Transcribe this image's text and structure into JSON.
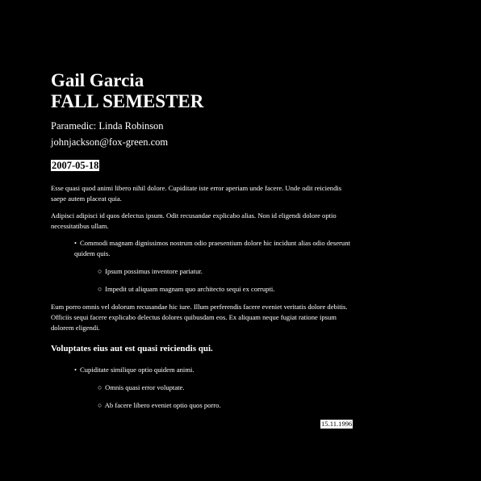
{
  "header": {
    "name": "Gail Garcia",
    "semester": "FALL SEMESTER",
    "role_line": "Paramedic: Linda Robinson",
    "email": "johnjackson@fox-green.com",
    "date": "2007-05-18"
  },
  "body": {
    "paragraph_1": "Esse quasi quod animi libero nihil dolore. Cupiditate iste error aperiam unde facere. Unde odit reiciendis saepe autem placeat quia.",
    "paragraph_2": "Adipisci adipisci id quos delectus ipsum. Odit recusandae explicabo alias. Non id eligendi dolore optio necessitatibus ullam.",
    "list_1": {
      "item_1": "Commodi magnam dignissimos nostrum odio praesentium dolore hic incidunt alias odio deserunt quidem quis.",
      "subitems": [
        "Ipsum possimus inventore pariatur.",
        "Impedit ut aliquam magnam quo architecto sequi ex corrupti."
      ]
    },
    "paragraph_3": "Eum porro omnis vel dolorum recusandae hic iure. Illum perferendis facere eveniet veritatis dolore debitis. Officiis sequi facere explicabo delectus dolores quibusdam eos. Ex aliquam neque fugiat ratione ipsum dolorem eligendi.",
    "heading": "Voluptates eius aut est quasi reiciendis qui.",
    "list_2": {
      "item_1": "Cupiditate similique optio quidem animi.",
      "subitems": [
        "Omnis quasi error voluptate.",
        "Ab facere libero eveniet optio quos porro."
      ]
    },
    "footer_date": "15.11.1996"
  },
  "icons": {
    "bullet_filled": "•",
    "bullet_hollow": "○"
  },
  "colors": {
    "background": "#000000",
    "text": "#ffffff",
    "highlight_bg": "#ffffff",
    "highlight_text": "#000000"
  }
}
